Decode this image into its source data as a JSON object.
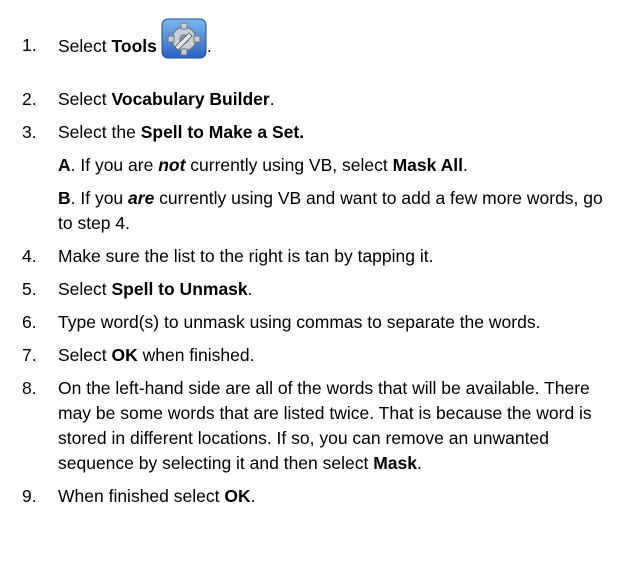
{
  "steps": [
    {
      "num": "1.",
      "pre": "Select ",
      "bold": "Tools",
      "post": "."
    },
    {
      "num": "2.",
      "pre": "Select ",
      "bold": "Vocabulary Builder",
      "post": "."
    },
    {
      "num": "3.",
      "pre": "Select the ",
      "bold": "Spell to Make a Set.",
      "post": ""
    },
    {
      "num": "4.",
      "text": "Make sure the list to the right is tan by tapping it."
    },
    {
      "num": "5.",
      "pre": "Select ",
      "bold": "Spell to Unmask",
      "post": "."
    },
    {
      "num": "6.",
      "text": "Type word(s) to unmask using commas to separate the words."
    },
    {
      "num": "7.",
      "pre": "Select ",
      "bold": "OK",
      "post": " when finished."
    },
    {
      "num": "8.",
      "pre": "On the left-hand side are all of the words that will be available. There may be some words that are listed twice. That is because the word is stored in different locations. If so, you can remove an unwanted sequence by selecting it and then select ",
      "bold": "Mask",
      "post": "."
    },
    {
      "num": "9.",
      "pre": "When finished select ",
      "bold": "OK",
      "post": "."
    }
  ],
  "substeps": {
    "a": {
      "letter": "A",
      "pre": ". If you are ",
      "emph": "not",
      "mid": " currently using VB, select ",
      "bold": "Mask All",
      "post": "."
    },
    "b": {
      "letter": "B",
      "pre": ". If you ",
      "emph": "are",
      "post": " currently using VB and want to add a few more words, go to step 4."
    }
  },
  "icons": {
    "tools": "gear-wrench-icon"
  }
}
